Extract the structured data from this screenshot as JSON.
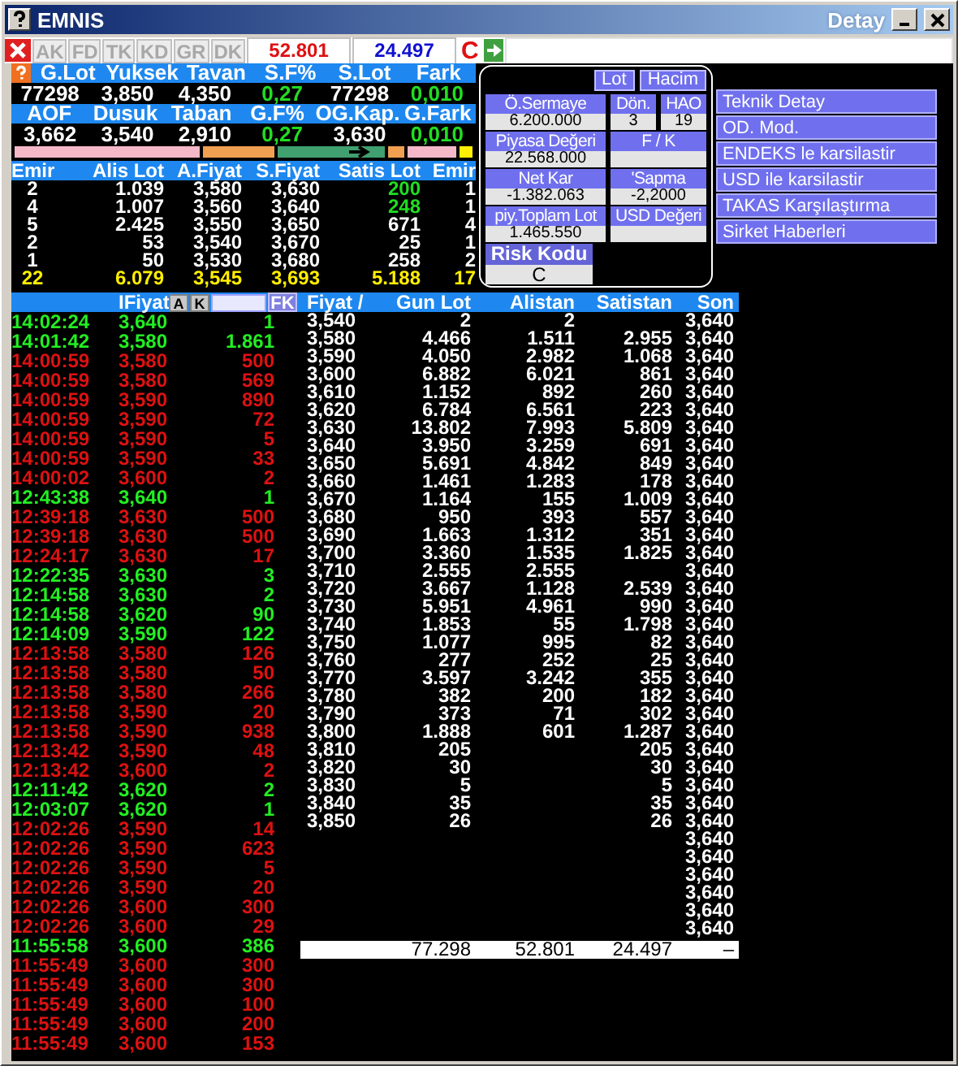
{
  "window": {
    "title": "EMNIS",
    "subtitle": "Detay"
  },
  "toolbar": {
    "tabs": [
      {
        "label": "AK",
        "disabled": true
      },
      {
        "label": "FD",
        "disabled": true
      },
      {
        "label": "TK",
        "disabled": true
      },
      {
        "label": "KD",
        "disabled": true
      },
      {
        "label": "GR",
        "disabled": true
      },
      {
        "label": "DK",
        "disabled": true
      }
    ],
    "sell_total": "52.801",
    "buy_total": "24.497",
    "risk": "C"
  },
  "stats": [
    {
      "fields": [
        {
          "label": "G.Lot",
          "value": "77298",
          "positive": false
        },
        {
          "label": "Yuksek",
          "value": "3,850",
          "positive": false
        },
        {
          "label": "Tavan",
          "value": "4,350",
          "positive": false
        },
        {
          "label": "S.F%",
          "value": "0,27",
          "positive": true
        },
        {
          "label": "S.Lot",
          "value": "77298",
          "positive": false
        },
        {
          "label": "Fark",
          "value": "0,010",
          "positive": true
        }
      ]
    },
    {
      "fields": [
        {
          "label": "AOF",
          "value": "3,662",
          "positive": false
        },
        {
          "label": "Dusuk",
          "value": "3,540",
          "positive": false
        },
        {
          "label": "Taban",
          "value": "2,910",
          "positive": false
        },
        {
          "label": "G.F%",
          "value": "0,27",
          "positive": true
        },
        {
          "label": "OG.Kap.",
          "value": "3,630",
          "positive": false
        },
        {
          "label": "G.Fark",
          "value": "0,010",
          "positive": true
        }
      ]
    }
  ],
  "order_book": {
    "columns": [
      "Emir",
      "Alis Lot",
      "A.Fiyat",
      "S.Fiyat",
      "Satis Lot",
      "Emir"
    ],
    "rows": [
      {
        "cells": [
          "2",
          "1.039",
          "3,580",
          "3,630",
          "200",
          "1"
        ],
        "color": "#22dd22"
      },
      {
        "cells": [
          "4",
          "1.007",
          "3,560",
          "3,640",
          "248",
          "1"
        ],
        "color": "#22dd22"
      },
      {
        "cells": [
          "5",
          "2.425",
          "3,550",
          "3,650",
          "671",
          "4"
        ],
        "color": "#ffffff"
      },
      {
        "cells": [
          "2",
          "53",
          "3,540",
          "3,670",
          "25",
          "1"
        ],
        "color": "#ffffff"
      },
      {
        "cells": [
          "1",
          "50",
          "3,530",
          "3,680",
          "258",
          "2"
        ],
        "color": "#ffffff"
      }
    ],
    "totals": [
      "22",
      "6.079",
      "3,545",
      "3,693",
      "5.188",
      "17"
    ]
  },
  "info_panel": {
    "buttons": [
      "Lot",
      "Hacim"
    ],
    "rows": [
      [
        {
          "label": "Ö.Sermaye",
          "value": "6.200.000"
        },
        {
          "label": "Dön.",
          "value": "3"
        },
        {
          "label": "HAO",
          "value": "19"
        }
      ],
      [
        {
          "label": "Piyasa Değeri",
          "value": "22.568.000"
        },
        {
          "label": "F / K"
        }
      ],
      [
        {
          "label": "Net Kar",
          "value": "-1.382.063"
        },
        {
          "label": "'Sapma",
          "value": "-2,2000"
        }
      ],
      [
        {
          "label": "piy.Toplam Lot",
          "value": "1.465.550"
        },
        {
          "label": "USD Değeri"
        }
      ]
    ],
    "risk": {
      "label": "Risk Kodu",
      "value": "C"
    }
  },
  "menu": [
    "Teknik Detay",
    "OD. Mod.",
    "ENDEKS le karsilastir",
    "USD ile karsilastir",
    "TAKAS Karşılaştırma",
    "Sirket Haberleri"
  ],
  "trades": {
    "header": "IFiyat",
    "buttons": [
      "A",
      "K"
    ],
    "filter_button": "FK",
    "rows": [
      {
        "time": "14:02:24",
        "price": "3,640",
        "lot": "1",
        "buy": true
      },
      {
        "time": "14:01:42",
        "price": "3,580",
        "lot": "1.861",
        "buy": true
      },
      {
        "time": "14:00:59",
        "price": "3,580",
        "lot": "500",
        "buy": false
      },
      {
        "time": "14:00:59",
        "price": "3,580",
        "lot": "569",
        "buy": false
      },
      {
        "time": "14:00:59",
        "price": "3,590",
        "lot": "890",
        "buy": false
      },
      {
        "time": "14:00:59",
        "price": "3,590",
        "lot": "72",
        "buy": false
      },
      {
        "time": "14:00:59",
        "price": "3,590",
        "lot": "5",
        "buy": false
      },
      {
        "time": "14:00:59",
        "price": "3,590",
        "lot": "33",
        "buy": false
      },
      {
        "time": "14:00:02",
        "price": "3,600",
        "lot": "2",
        "buy": false
      },
      {
        "time": "12:43:38",
        "price": "3,640",
        "lot": "1",
        "buy": true
      },
      {
        "time": "12:39:18",
        "price": "3,630",
        "lot": "500",
        "buy": false
      },
      {
        "time": "12:39:18",
        "price": "3,630",
        "lot": "500",
        "buy": false
      },
      {
        "time": "12:24:17",
        "price": "3,630",
        "lot": "17",
        "buy": false
      },
      {
        "time": "12:22:35",
        "price": "3,630",
        "lot": "3",
        "buy": true
      },
      {
        "time": "12:14:58",
        "price": "3,630",
        "lot": "2",
        "buy": true
      },
      {
        "time": "12:14:58",
        "price": "3,620",
        "lot": "90",
        "buy": true
      },
      {
        "time": "12:14:09",
        "price": "3,590",
        "lot": "122",
        "buy": true
      },
      {
        "time": "12:13:58",
        "price": "3,580",
        "lot": "126",
        "buy": false
      },
      {
        "time": "12:13:58",
        "price": "3,580",
        "lot": "50",
        "buy": false
      },
      {
        "time": "12:13:58",
        "price": "3,580",
        "lot": "266",
        "buy": false
      },
      {
        "time": "12:13:58",
        "price": "3,590",
        "lot": "20",
        "buy": false
      },
      {
        "time": "12:13:58",
        "price": "3,590",
        "lot": "938",
        "buy": false
      },
      {
        "time": "12:13:42",
        "price": "3,590",
        "lot": "48",
        "buy": false
      },
      {
        "time": "12:13:42",
        "price": "3,600",
        "lot": "2",
        "buy": false
      },
      {
        "time": "12:11:42",
        "price": "3,620",
        "lot": "2",
        "buy": true
      },
      {
        "time": "12:03:07",
        "price": "3,620",
        "lot": "1",
        "buy": true
      },
      {
        "time": "12:02:26",
        "price": "3,590",
        "lot": "14",
        "buy": false
      },
      {
        "time": "12:02:26",
        "price": "3,590",
        "lot": "623",
        "buy": false
      },
      {
        "time": "12:02:26",
        "price": "3,590",
        "lot": "5",
        "buy": false
      },
      {
        "time": "12:02:26",
        "price": "3,590",
        "lot": "20",
        "buy": false
      },
      {
        "time": "12:02:26",
        "price": "3,600",
        "lot": "300",
        "buy": false
      },
      {
        "time": "12:02:26",
        "price": "3,600",
        "lot": "29",
        "buy": false
      },
      {
        "time": "11:55:58",
        "price": "3,600",
        "lot": "386",
        "buy": true
      },
      {
        "time": "11:55:49",
        "price": "3,600",
        "lot": "300",
        "buy": false
      },
      {
        "time": "11:55:49",
        "price": "3,600",
        "lot": "300",
        "buy": false
      },
      {
        "time": "11:55:49",
        "price": "3,600",
        "lot": "100",
        "buy": false
      },
      {
        "time": "11:55:49",
        "price": "3,600",
        "lot": "200",
        "buy": false
      },
      {
        "time": "11:55:49",
        "price": "3,600",
        "lot": "153",
        "buy": false
      }
    ]
  },
  "price_table": {
    "columns": [
      "Fiyat /",
      "Gun Lot",
      "Alistan",
      "Satistan",
      "Son"
    ],
    "rows": [
      {
        "fiyat": "3,540",
        "gun_lot": "2",
        "alistan": "2",
        "son": "3,640"
      },
      {
        "fiyat": "3,580",
        "gun_lot": "4.466",
        "alistan": "1.511",
        "satistan": "2.955",
        "son": "3,640"
      },
      {
        "fiyat": "3,590",
        "gun_lot": "4.050",
        "alistan": "2.982",
        "satistan": "1.068",
        "son": "3,640"
      },
      {
        "fiyat": "3,600",
        "gun_lot": "6.882",
        "alistan": "6.021",
        "satistan": "861",
        "son": "3,640"
      },
      {
        "fiyat": "3,610",
        "gun_lot": "1.152",
        "alistan": "892",
        "satistan": "260",
        "son": "3,640"
      },
      {
        "fiyat": "3,620",
        "gun_lot": "6.784",
        "alistan": "6.561",
        "satistan": "223",
        "son": "3,640"
      },
      {
        "fiyat": "3,630",
        "gun_lot": "13.802",
        "alistan": "7.993",
        "satistan": "5.809",
        "son": "3,640"
      },
      {
        "fiyat": "3,640",
        "gun_lot": "3.950",
        "alistan": "3.259",
        "satistan": "691",
        "son": "3,640"
      },
      {
        "fiyat": "3,650",
        "gun_lot": "5.691",
        "alistan": "4.842",
        "satistan": "849",
        "son": "3,640"
      },
      {
        "fiyat": "3,660",
        "gun_lot": "1.461",
        "alistan": "1.283",
        "satistan": "178",
        "son": "3,640"
      },
      {
        "fiyat": "3,670",
        "gun_lot": "1.164",
        "alistan": "155",
        "satistan": "1.009",
        "son": "3,640"
      },
      {
        "fiyat": "3,680",
        "gun_lot": "950",
        "alistan": "393",
        "satistan": "557",
        "son": "3,640"
      },
      {
        "fiyat": "3,690",
        "gun_lot": "1.663",
        "alistan": "1.312",
        "satistan": "351",
        "son": "3,640"
      },
      {
        "fiyat": "3,700",
        "gun_lot": "3.360",
        "alistan": "1.535",
        "satistan": "1.825",
        "son": "3,640"
      },
      {
        "fiyat": "3,710",
        "gun_lot": "2.555",
        "alistan": "2.555",
        "son": "3,640"
      },
      {
        "fiyat": "3,720",
        "gun_lot": "3.667",
        "alistan": "1.128",
        "satistan": "2.539",
        "son": "3,640"
      },
      {
        "fiyat": "3,730",
        "gun_lot": "5.951",
        "alistan": "4.961",
        "satistan": "990",
        "son": "3,640"
      },
      {
        "fiyat": "3,740",
        "gun_lot": "1.853",
        "alistan": "55",
        "satistan": "1.798",
        "son": "3,640"
      },
      {
        "fiyat": "3,750",
        "gun_lot": "1.077",
        "alistan": "995",
        "satistan": "82",
        "son": "3,640"
      },
      {
        "fiyat": "3,760",
        "gun_lot": "277",
        "alistan": "252",
        "satistan": "25",
        "son": "3,640"
      },
      {
        "fiyat": "3,770",
        "gun_lot": "3.597",
        "alistan": "3.242",
        "satistan": "355",
        "son": "3,640"
      },
      {
        "fiyat": "3,780",
        "gun_lot": "382",
        "alistan": "200",
        "satistan": "182",
        "son": "3,640"
      },
      {
        "fiyat": "3,790",
        "gun_lot": "373",
        "alistan": "71",
        "satistan": "302",
        "son": "3,640"
      },
      {
        "fiyat": "3,800",
        "gun_lot": "1.888",
        "alistan": "601",
        "satistan": "1.287",
        "son": "3,640"
      },
      {
        "fiyat": "3,810",
        "gun_lot": "205",
        "satistan": "205",
        "son": "3,640"
      },
      {
        "fiyat": "3,820",
        "gun_lot": "30",
        "satistan": "30",
        "son": "3,640"
      },
      {
        "fiyat": "3,830",
        "gun_lot": "5",
        "satistan": "5",
        "son": "3,640"
      },
      {
        "fiyat": "3,840",
        "gun_lot": "35",
        "satistan": "35",
        "son": "3,640"
      },
      {
        "fiyat": "3,850",
        "gun_lot": "26",
        "satistan": "26",
        "son": "3,640"
      },
      {
        "son": "3,640"
      },
      {
        "son": "3,640"
      },
      {
        "son": "3,640"
      },
      {
        "son": "3,640"
      },
      {
        "son": "3,640"
      },
      {
        "son": "3,640"
      }
    ],
    "totals": {
      "gun_lot": "77.298",
      "alistan": "52.801",
      "satistan": "24.497",
      "son": "–"
    }
  }
}
